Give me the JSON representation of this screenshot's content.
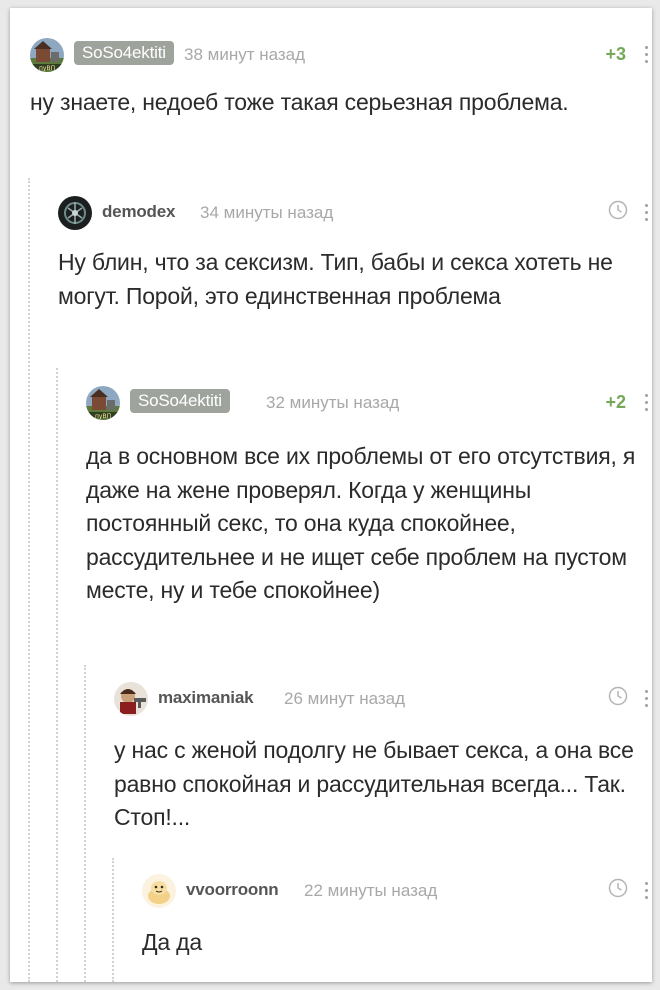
{
  "comments": [
    {
      "username": "SoSo4ektiti",
      "time": "38 минут назад",
      "rating": "+3",
      "text": "ну знаете, недоеб тоже такая серьезная проблема.",
      "is_op": true
    },
    {
      "username": "demodex",
      "time": "34 минуты назад",
      "text": "Ну блин, что за сексизм. Тип, бабы и секса хотеть не могут. Порой, это единственная проблема",
      "is_op": false
    },
    {
      "username": "SoSo4ektiti",
      "time": "32 минуты назад",
      "rating": "+2",
      "text": "да в основном все их проблемы от его отсутствия, я даже на жене проверял. Когда у женщины постоянный секс, то она куда спокойнее, рассудительнее и не ищет себе проблем на пустом месте, ну и тебе спокойнее)",
      "is_op": true
    },
    {
      "username": "maximaniak",
      "time": "26 минут назад",
      "text": "у нас с женой подолгу не бывает секса, а она все равно спокойная и рассудительная всегда... Так. Стоп!...",
      "is_op": false
    },
    {
      "username": "vvoorroonn",
      "time": "22 минуты назад",
      "text": "Да да",
      "is_op": false
    }
  ],
  "colors": {
    "op_badge_bg": "#9ea39c",
    "rating_positive": "#76a85a",
    "meta_gray": "#a8a8a8",
    "branch_line": "#d2d2d2"
  },
  "icons": [
    "clock-icon",
    "more-options-icon"
  ]
}
